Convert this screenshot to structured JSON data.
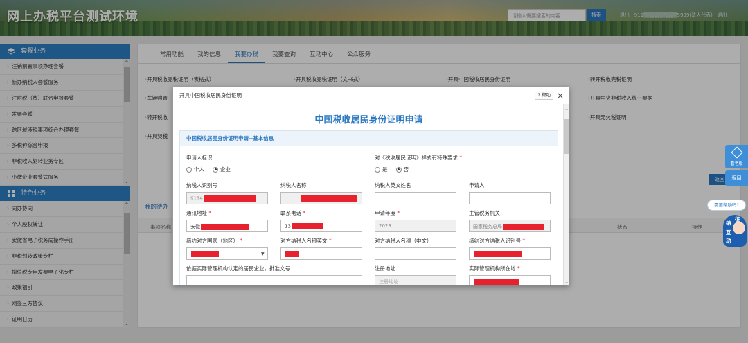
{
  "header": {
    "title": "网上办税平台测试环境",
    "search_placeholder": "请输入需要搜索的内容",
    "search_button": "搜索",
    "user_info": "退出 | 911▒▒▒▒▒▒▒▒▒5999(法人代表) | 退出"
  },
  "sidebar": {
    "section1_title": "套餐业务",
    "section1_items": [
      "注销前置事项办理套餐",
      "新办纳税人套餐服务",
      "注附税（费）联合申报套餐",
      "发票套餐",
      "跨区域涉税事项综合办理套餐",
      "多税种综合申报",
      "非税收入划转业务专区",
      "小微企业套餐式服务"
    ],
    "section2_title": "特色业务",
    "section2_items": [
      "同办协同",
      "个人股权转让",
      "安徽省电子税务局操作手册",
      "非税划转政策专栏",
      "增值税专用发票电子化专栏",
      "政策福引",
      "网签三方协议",
      "证明日历"
    ]
  },
  "main": {
    "tabs": [
      "常用功能",
      "我的信息",
      "我要办税",
      "我要查询",
      "互动中心",
      "公众服务"
    ],
    "active_tab": "我要办税",
    "links": [
      "开具税收完税证明（表格式）",
      "开具税收完税证明（文书式）",
      "开具中国税收居民身份证明",
      "转开税收完税证明",
      "车辆购置",
      "开具中央非税收入统一票据",
      "转开税收",
      "开具无欠税证明",
      "开具契税"
    ],
    "return_button": "返回",
    "section2_tab": "我的待办",
    "table_headers": [
      "事项名称",
      "状态",
      "操作"
    ]
  },
  "floats": {
    "edit_label": "看老版",
    "top_label": "返回",
    "help_bubble": "需要帮助吗?",
    "mascot": [
      "纳",
      "征",
      "互",
      "动"
    ]
  },
  "dialog": {
    "title": "开具中国税收居民身份证明",
    "help": "? 帮助",
    "close": "×",
    "form_title": "中国税收居民身份证明申请",
    "section_title": "中国税收居民身份证明申请--基本信息",
    "fields": {
      "applicant_type_label": "申请人标识",
      "applicant_type_options": [
        "个人",
        "企业"
      ],
      "applicant_type_selected": "企业",
      "special_format_label": "对《税收居民证明》样式有特殊要求",
      "special_format_options": [
        "是",
        "否"
      ],
      "special_format_selected": "否",
      "taxpayer_id_label": "纳税人识别号",
      "taxpayer_id_value": "9134",
      "taxpayer_name_label": "纳税人名称",
      "taxpayer_en_name_label": "纳税人英文姓名",
      "applicant_label": "申请人",
      "address_label": "通讯地址",
      "address_value": "安徽",
      "phone_label": "联系电话",
      "phone_value": "13",
      "year_label": "申请年度",
      "year_value": "2023",
      "tax_office_label": "主管税务机关",
      "tax_office_value": "国家税务总局",
      "country_label": "缔约对方国家（地区）",
      "partner_en_name_label": "对方纳税人名称英文",
      "partner_cn_name_label": "对方纳税人名称（中文）",
      "partner_tax_id_label": "缔约对方纳税人识别号",
      "resident_doc_label": "依据实际管理机构认定的居民企业，批准文号",
      "reg_address_label": "注册地址",
      "reg_address_placeholder": "注册地址",
      "mgmt_location_label": "实际管理机构所在地"
    }
  },
  "colors": {
    "accent": "#2b78c2",
    "redaction": "#e8212e",
    "required": "#e22233"
  }
}
